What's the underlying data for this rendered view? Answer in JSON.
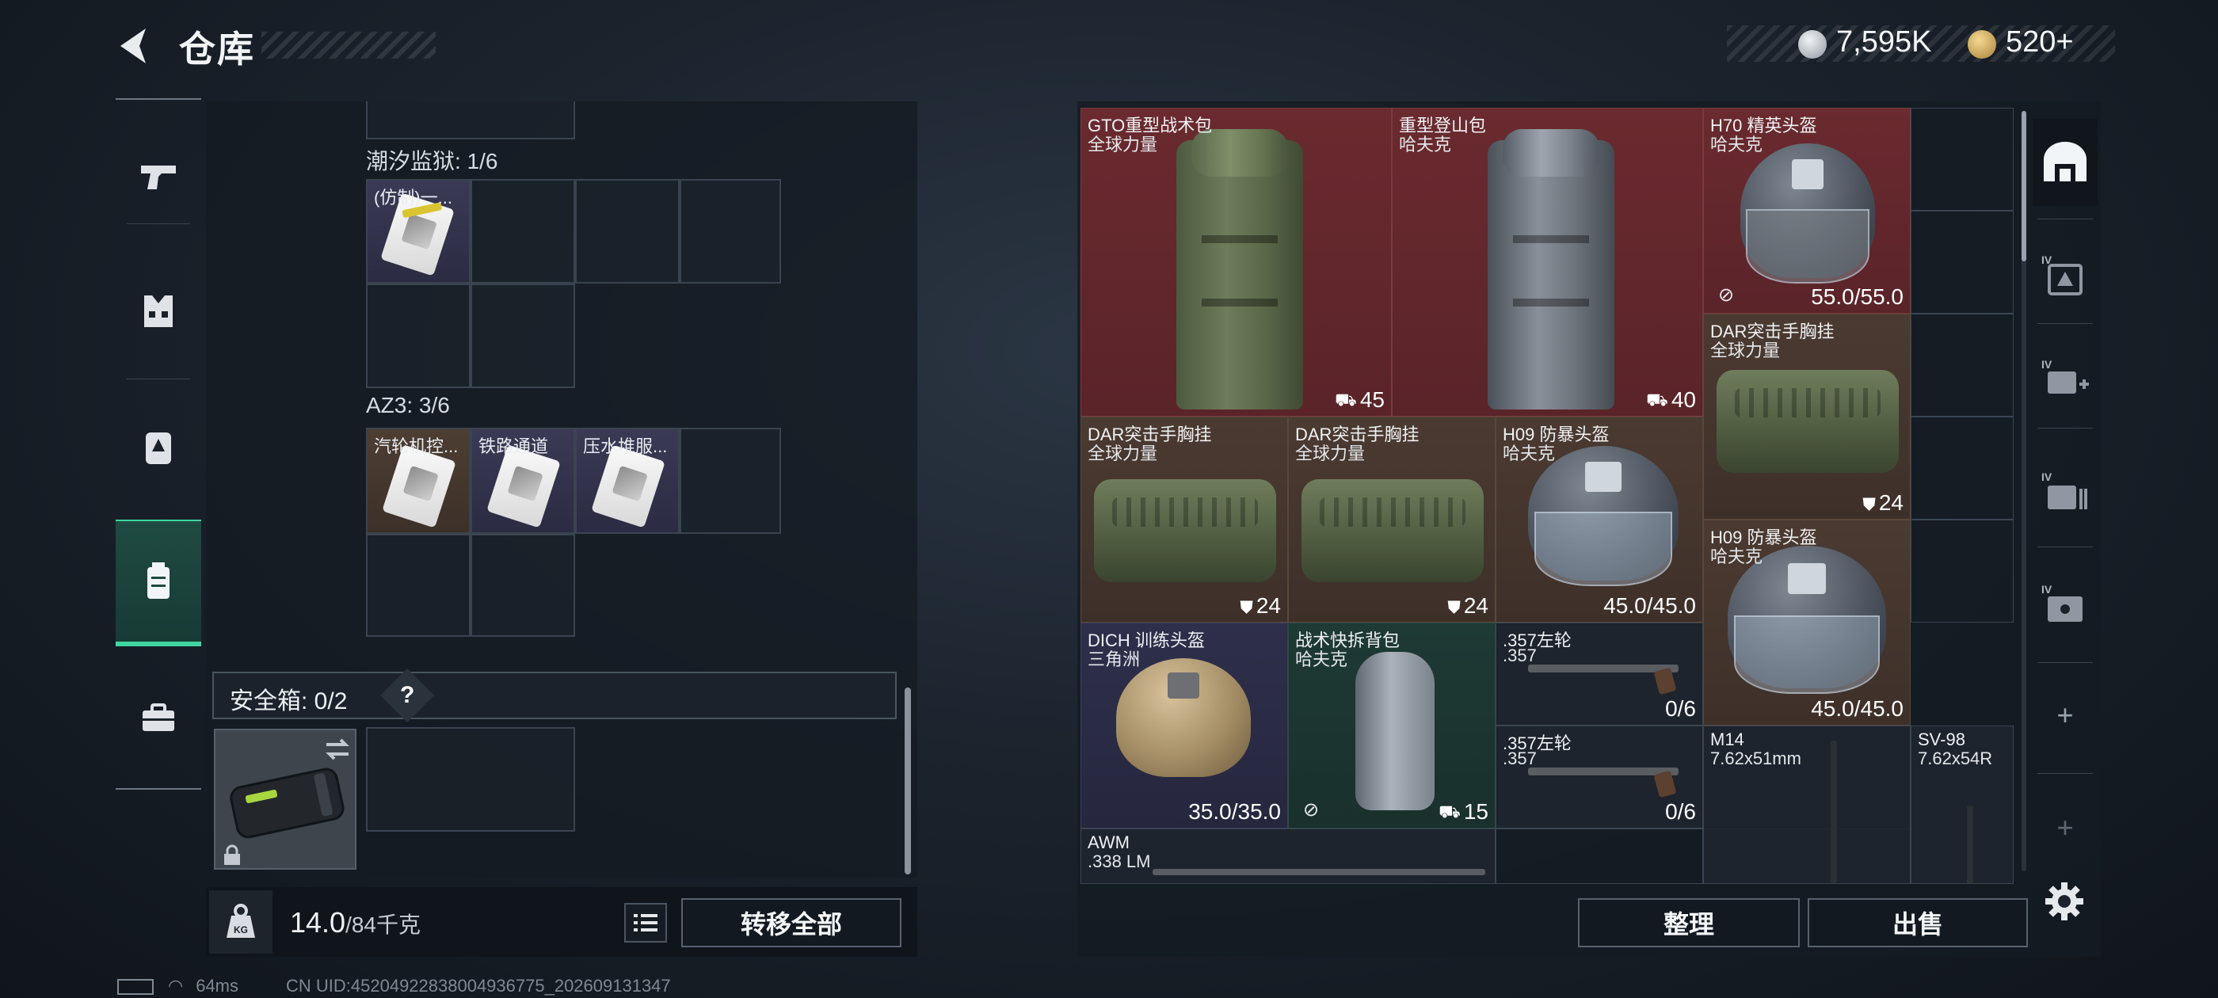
{
  "header": {
    "title": "仓库",
    "currencies": [
      {
        "icon": "silver-coin-icon",
        "value": "7,595K"
      },
      {
        "icon": "gold-coin-icon",
        "value": "520+"
      }
    ]
  },
  "left_rail": {
    "items": [
      {
        "name": "weapon",
        "icon": "pistol-icon"
      },
      {
        "name": "vest",
        "icon": "vest-icon"
      },
      {
        "name": "backpack",
        "icon": "backpack-icon"
      },
      {
        "name": "container",
        "icon": "container-icon",
        "active": true
      },
      {
        "name": "case",
        "icon": "briefcase-icon"
      }
    ]
  },
  "storage": {
    "sections": [
      {
        "label": "潮汐监狱: 1/6",
        "items": [
          "(仿制)一..."
        ]
      },
      {
        "label": "AZ3: 3/6",
        "items": [
          "汽轮机控...",
          "铁路通道",
          "压水堆服..."
        ]
      }
    ],
    "safe_box": {
      "label": "安全箱: 0/2",
      "help": "?"
    }
  },
  "weight": {
    "current": "14.0",
    "max": "/84千克"
  },
  "buttons": {
    "transfer_all": "转移全部",
    "sort": "整理",
    "sell": "出售"
  },
  "status": {
    "ping": "64ms",
    "uid": "CN UID:45204922838004936775_202609131347"
  },
  "stash_items": [
    {
      "line1": "GTO重型战术包",
      "line2": "全球力量",
      "value": "45",
      "value_icon": "backpack-capacity-icon",
      "rarity": "red"
    },
    {
      "line1": "重型登山包",
      "line2": "哈夫克",
      "value": "40",
      "value_icon": "backpack-capacity-icon",
      "rarity": "red"
    },
    {
      "line1": "H70 精英头盔",
      "line2": "哈夫克",
      "value": "55.0/55.0",
      "value_icon": "armor-icon",
      "rarity": "red"
    },
    {
      "line1": "DAR突击手胸挂",
      "line2": "全球力量",
      "value": "24",
      "value_icon": "vest-capacity-icon",
      "rarity": "brown"
    },
    {
      "line1": "DAR突击手胸挂",
      "line2": "全球力量",
      "value": "24",
      "value_icon": "vest-capacity-icon",
      "rarity": "brown"
    },
    {
      "line1": "DAR突击手胸挂",
      "line2": "全球力量",
      "value": "24",
      "value_icon": "vest-capacity-icon",
      "rarity": "brown"
    },
    {
      "line1": "H09 防暴头盔",
      "line2": "哈夫克",
      "value": "45.0/45.0",
      "value_icon": "",
      "rarity": "brown"
    },
    {
      "line1": "H09 防暴头盔",
      "line2": "哈夫克",
      "value": "45.0/45.0",
      "value_icon": "",
      "rarity": "brown"
    },
    {
      "line1": "DICH 训练头盔",
      "line2": "三角洲",
      "value": "35.0/35.0",
      "value_icon": "armor-icon",
      "rarity": "purple"
    },
    {
      "line1": "战术快拆背包",
      "line2": "哈夫克",
      "value": "15",
      "value_icon": "backpack-capacity-icon",
      "rarity": "green"
    },
    {
      "line1": ".357左轮",
      "line2": ".357",
      "value": "0/6",
      "value_icon": "",
      "rarity": "gray"
    },
    {
      "line1": ".357左轮",
      "line2": ".357",
      "value": "0/6",
      "value_icon": "",
      "rarity": "gray"
    },
    {
      "line1": "M14",
      "line2": "7.62x51mm",
      "value": "",
      "value_icon": "",
      "rarity": "gray"
    },
    {
      "line1": "SV-98",
      "line2": "7.62x54R",
      "value": "",
      "value_icon": "",
      "rarity": "gray"
    },
    {
      "line1": "AWM",
      "line2": ".338 LM",
      "value": "",
      "value_icon": "",
      "rarity": "gray"
    }
  ],
  "right_rail": {
    "tabs": [
      {
        "name": "main",
        "icon": "stash-main-icon",
        "active": true
      },
      {
        "name": "tier-iv-1",
        "icon": "stash-tab-icon",
        "badge": "IV"
      },
      {
        "name": "tier-iv-2",
        "icon": "medical-tab-icon",
        "badge": "IV"
      },
      {
        "name": "tier-iv-3",
        "icon": "ammo-tab-icon",
        "badge": "IV"
      },
      {
        "name": "tier-iv-4",
        "icon": "key-tab-icon",
        "badge": "IV"
      }
    ],
    "add_label": "+"
  }
}
